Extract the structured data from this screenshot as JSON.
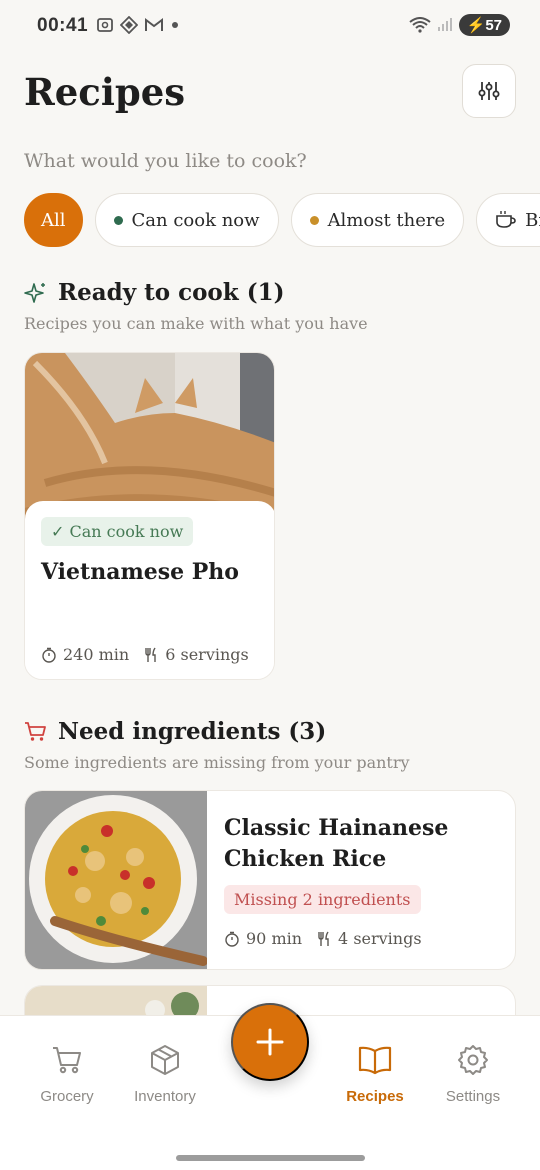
{
  "status": {
    "time": "00:41",
    "battery": "57"
  },
  "header": {
    "title": "Recipes",
    "subtitle": "What would you like to cook?"
  },
  "filters": [
    {
      "label": "All",
      "dot": null
    },
    {
      "label": "Can cook now",
      "dot": "#2f6b4f"
    },
    {
      "label": "Almost there",
      "dot": "#c9902a"
    },
    {
      "label": "Br",
      "icon": "cup-icon"
    }
  ],
  "ready": {
    "title": "Ready to cook (1)",
    "subtitle": "Recipes you can make with what you have",
    "recipe": {
      "badge": "✓ Can cook now",
      "name": "Vietnamese Pho",
      "time": "240 min",
      "servings": "6 servings"
    }
  },
  "need": {
    "title": "Need ingredients (3)",
    "subtitle": "Some ingredients are missing from your pantry",
    "recipes": [
      {
        "name": "Classic Hainanese Chicken Rice",
        "badge": "Missing 2 ingredients",
        "time": "90 min",
        "servings": "4 servings"
      }
    ]
  },
  "nav": {
    "grocery": "Grocery",
    "inventory": "Inventory",
    "recipes": "Recipes",
    "settings": "Settings"
  },
  "colors": {
    "accent": "#d9700a",
    "ok": "#467a55",
    "missing": "#c05050"
  }
}
